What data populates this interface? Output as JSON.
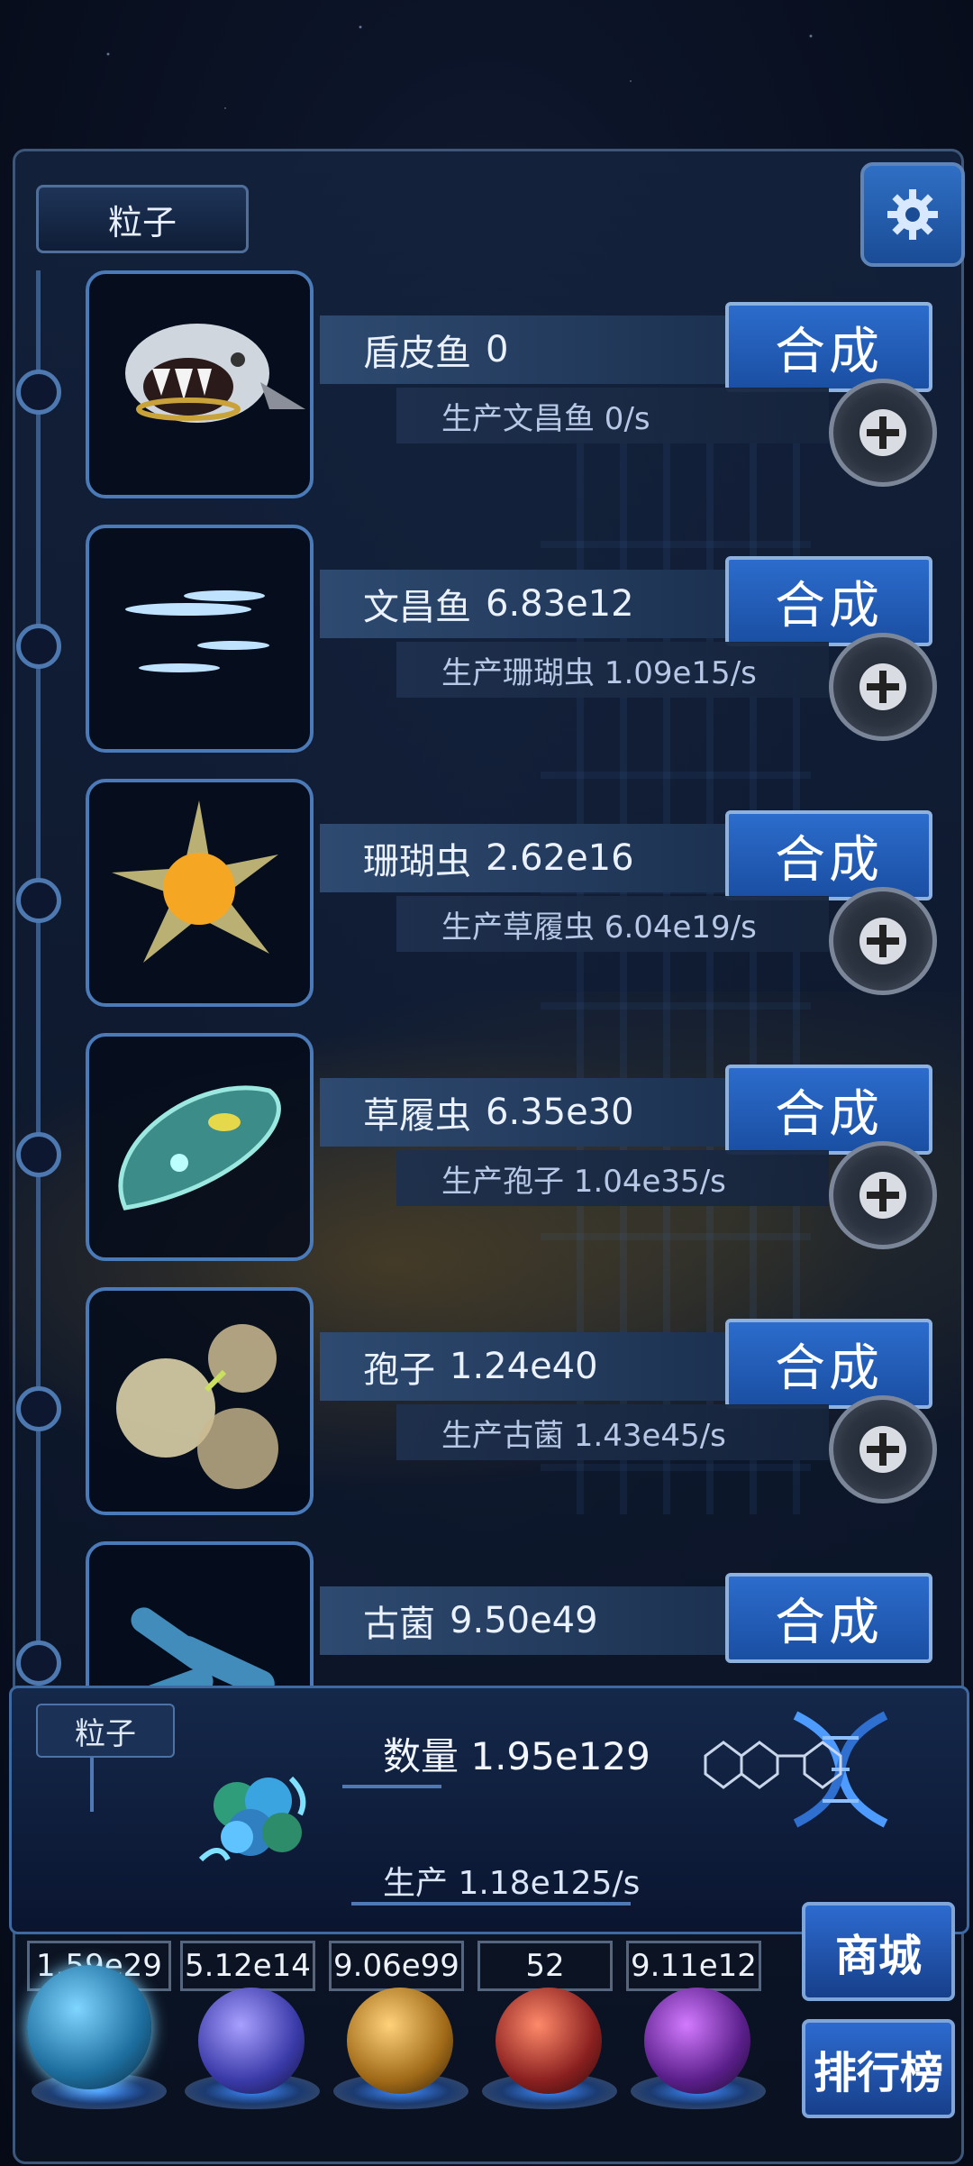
{
  "header": {
    "tab_label": "粒子",
    "settings_icon": "gear-icon"
  },
  "creatures": [
    {
      "name": "盾皮鱼",
      "count": "0",
      "production": "生产文昌鱼 0/s",
      "synth_label": "合成",
      "icon": "armored-fish-icon"
    },
    {
      "name": "文昌鱼",
      "count": "6.83e12",
      "production": "生产珊瑚虫 1.09e15/s",
      "synth_label": "合成",
      "icon": "lancelet-icon"
    },
    {
      "name": "珊瑚虫",
      "count": "2.62e16",
      "production": "生产草履虫 6.04e19/s",
      "synth_label": "合成",
      "icon": "coral-polyp-icon"
    },
    {
      "name": "草履虫",
      "count": "6.35e30",
      "production": "生产孢子 1.04e35/s",
      "synth_label": "合成",
      "icon": "paramecium-icon"
    },
    {
      "name": "孢子",
      "count": "1.24e40",
      "production": "生产古菌 1.43e45/s",
      "synth_label": "合成",
      "icon": "spore-icon"
    },
    {
      "name": "古菌",
      "count": "9.50e49",
      "production": "",
      "synth_label": "合成",
      "icon": "archaea-icon"
    }
  ],
  "summary": {
    "tab_label": "粒子",
    "count_text": "数量 1.95e129",
    "rate_text": "生产 1.18e125/s"
  },
  "resources": [
    {
      "value": "1.59e29",
      "icon": "particle-orb-icon"
    },
    {
      "value": "5.12e14",
      "icon": "lightning-orb-icon"
    },
    {
      "value": "9.06e99",
      "icon": "galaxy-orb-icon"
    },
    {
      "value": "52",
      "icon": "brain-orb-icon"
    },
    {
      "value": "9.11e12",
      "icon": "vortex-orb-icon"
    }
  ],
  "side_buttons": {
    "shop": "商城",
    "ranking": "排行榜"
  },
  "colors": {
    "accent": "#2c6ccc",
    "panel": "#15284a",
    "border": "#4a7ab8"
  }
}
